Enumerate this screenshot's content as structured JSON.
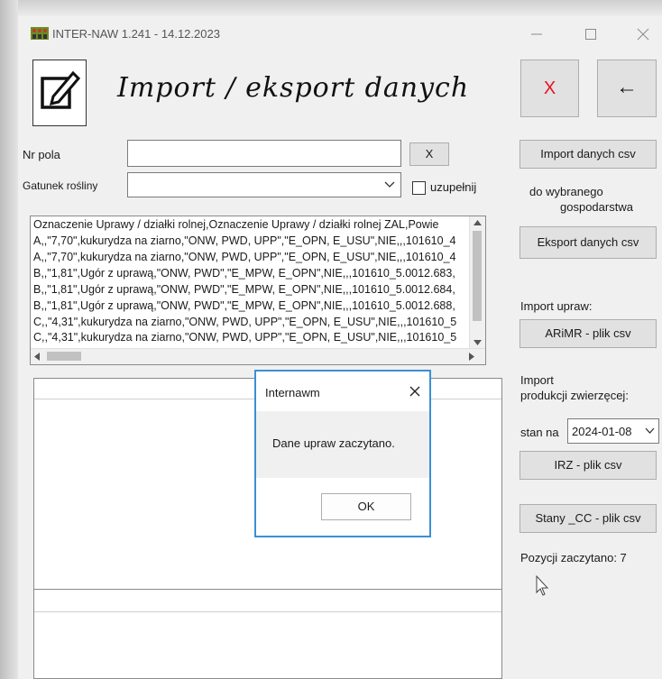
{
  "window": {
    "title": "INTER-NAW 1.241 - 14.12.2023"
  },
  "page": {
    "heading": "Import / eksport danych"
  },
  "toolbar": {
    "close_label": "X",
    "back_label": "←"
  },
  "form": {
    "nr_pola_label": "Nr pola",
    "nr_pola_value": "",
    "clear_label": "X",
    "gatunek_label": "Gatunek rośliny",
    "gatunek_value": "",
    "uzupelnij_label": "uzupełnij"
  },
  "csv_preview": [
    "Oznaczenie Uprawy / działki rolnej,Oznaczenie Uprawy / działki rolnej ZAL,Powie",
    "A,,\"7,70\",kukurydza na ziarno,\"ONW, PWD, UPP\",\"E_OPN, E_USU\",NIE,,,101610_4",
    "A,,\"7,70\",kukurydza na ziarno,\"ONW, PWD, UPP\",\"E_OPN, E_USU\",NIE,,,101610_4",
    "B,,\"1,81\",Ugór z uprawą,\"ONW, PWD\",\"E_MPW, E_OPN\",NIE,,,101610_5.0012.683,",
    "B,,\"1,81\",Ugór z uprawą,\"ONW, PWD\",\"E_MPW, E_OPN\",NIE,,,101610_5.0012.684,",
    "B,,\"1,81\",Ugór z uprawą,\"ONW, PWD\",\"E_MPW, E_OPN\",NIE,,,101610_5.0012.688,",
    "C,,\"4,31\",kukurydza na ziarno,\"ONW, PWD, UPP\",\"E_OPN, E_USU\",NIE,,,101610_5",
    "C,,\"4,31\",kukurydza na ziarno,\"ONW, PWD, UPP\",\"E_OPN, E_USU\",NIE,,,101610_5"
  ],
  "sidebar": {
    "import_csv_label": "Import danych csv",
    "do_wybranego": "do wybranego",
    "gospodarstwa": "gospodarstwa",
    "eksport_csv_label": "Eksport danych csv",
    "import_upraw": "Import upraw:",
    "arimr_label": "ARiMR - plik csv",
    "import": "Import",
    "produkcji": "produkcji zwierzęcej:",
    "stan_na": "stan na",
    "date_value": "2024-01-08",
    "irz_label": "IRZ - plik csv",
    "stany_cc_label": "Stany _CC - plik csv",
    "pozycji": "Pozycji zaczytano: 7"
  },
  "dialog": {
    "title": "Internawm",
    "message": "Dane upraw zaczytano.",
    "ok_label": "OK"
  },
  "colors": {
    "close_red": "#e81123",
    "dialog_border": "#3a8fd6"
  }
}
